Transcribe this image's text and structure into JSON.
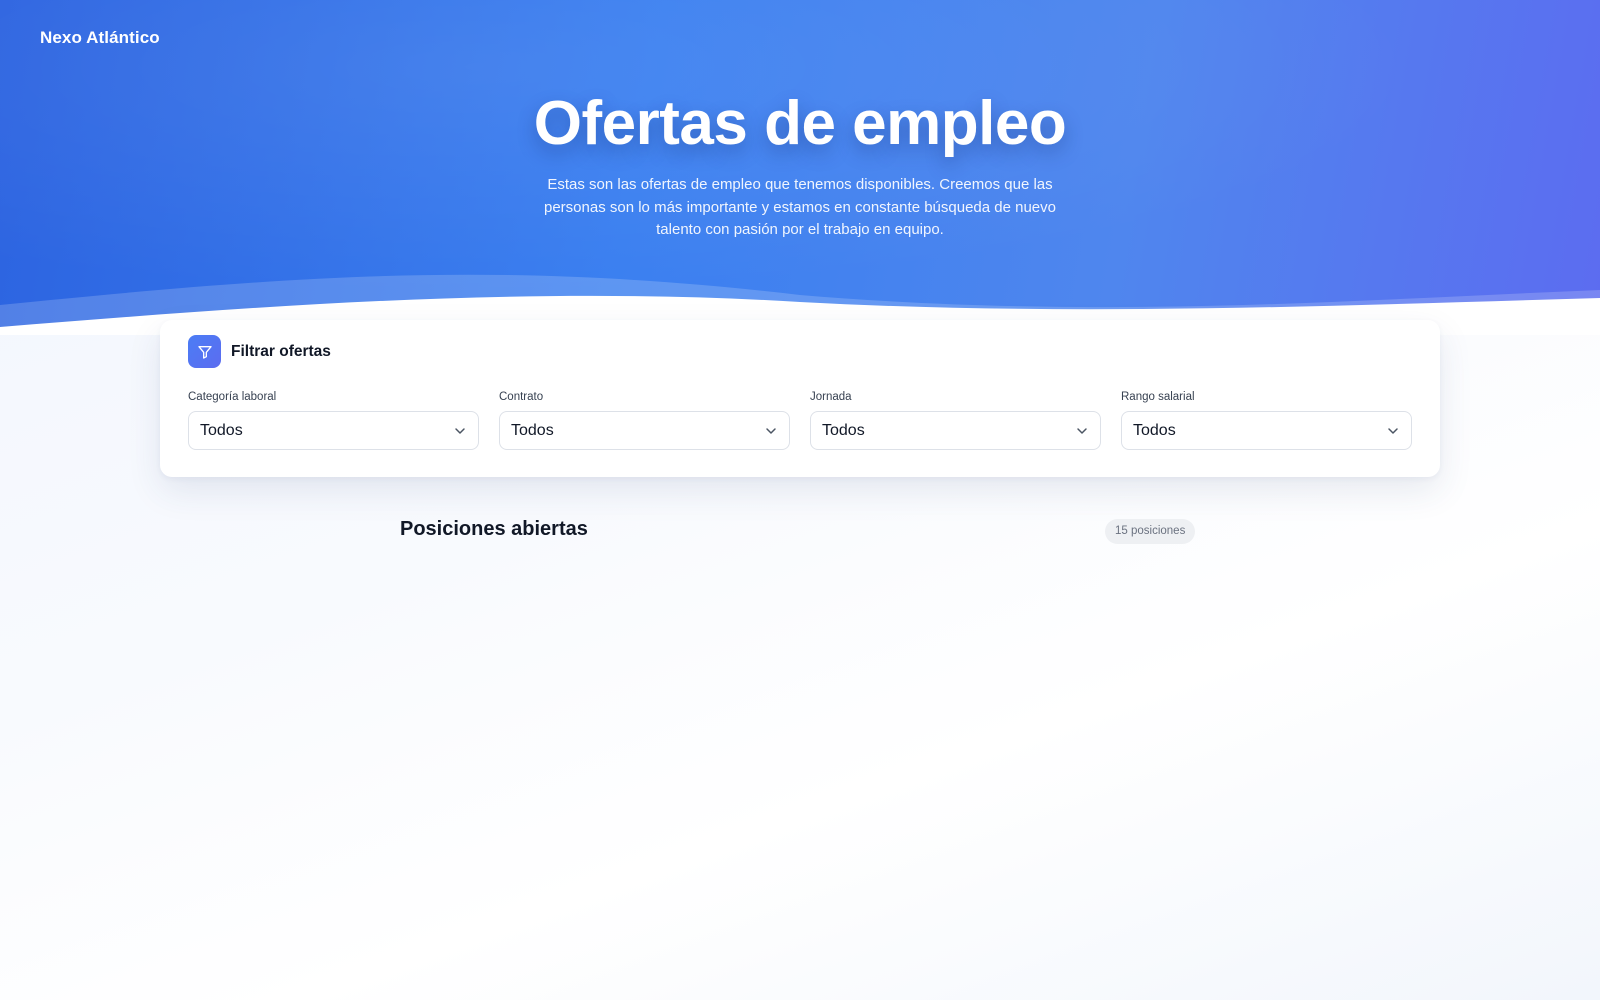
{
  "header": {
    "brand": "Nexo Atlántico",
    "title": "Ofertas de empleo",
    "subtitle": "Estas son las ofertas de empleo que tenemos disponibles. Creemos que las personas son lo más importante y estamos en constante búsqueda de nuevo talento con pasión por el trabajo en equipo."
  },
  "filters": {
    "title": "Filtrar ofertas",
    "icon": "funnel-icon",
    "fields": [
      {
        "label": "Categoría laboral",
        "value": "Todos"
      },
      {
        "label": "Contrato",
        "value": "Todos"
      },
      {
        "label": "Jornada",
        "value": "Todos"
      },
      {
        "label": "Rango salarial",
        "value": "Todos"
      }
    ]
  },
  "positions": {
    "title": "Posiciones abiertas",
    "count_label": "15 posiciones"
  },
  "colors": {
    "hero_start": "#2c63e0",
    "hero_end": "#5c6cf0",
    "accent": "#4b7df5"
  }
}
